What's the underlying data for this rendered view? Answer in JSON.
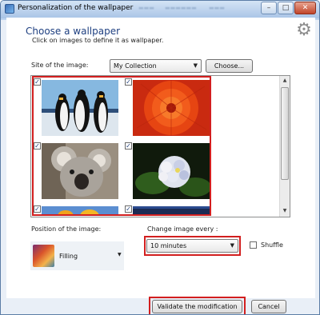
{
  "window": {
    "title": "Personalization of the wallpaper",
    "minimize_glyph": "–",
    "maximize_glyph": "□",
    "close_glyph": "✕"
  },
  "header": {
    "heading": "Choose a wallpaper",
    "subtitle": "Click on images to define it as wallpaper.",
    "gear_glyph": "⚙"
  },
  "site": {
    "label": "Site of the image:",
    "selected": "My Collection",
    "choose_button": "Choose..."
  },
  "gallery": {
    "thumbnails": [
      {
        "name": "penguins",
        "checked": true
      },
      {
        "name": "red-flower",
        "checked": true
      },
      {
        "name": "koala",
        "checked": true
      },
      {
        "name": "hydrangea",
        "checked": true
      },
      {
        "name": "tulips",
        "checked": true
      },
      {
        "name": "jellyfish",
        "checked": true
      }
    ],
    "check_glyph": "✓",
    "scroll_up_glyph": "▲",
    "scroll_down_glyph": "▼"
  },
  "position": {
    "label": "Position of the image:",
    "selected": "Filling"
  },
  "interval": {
    "label": "Change image every :",
    "selected": "10 minutes",
    "shuffle_label": "Shuffle",
    "shuffle_checked": false
  },
  "actions": {
    "validate_button": "Validate the modification",
    "cancel_button": "Cancel"
  },
  "colors": {
    "highlight": "#d21f1f",
    "heading": "#1e3f80"
  }
}
